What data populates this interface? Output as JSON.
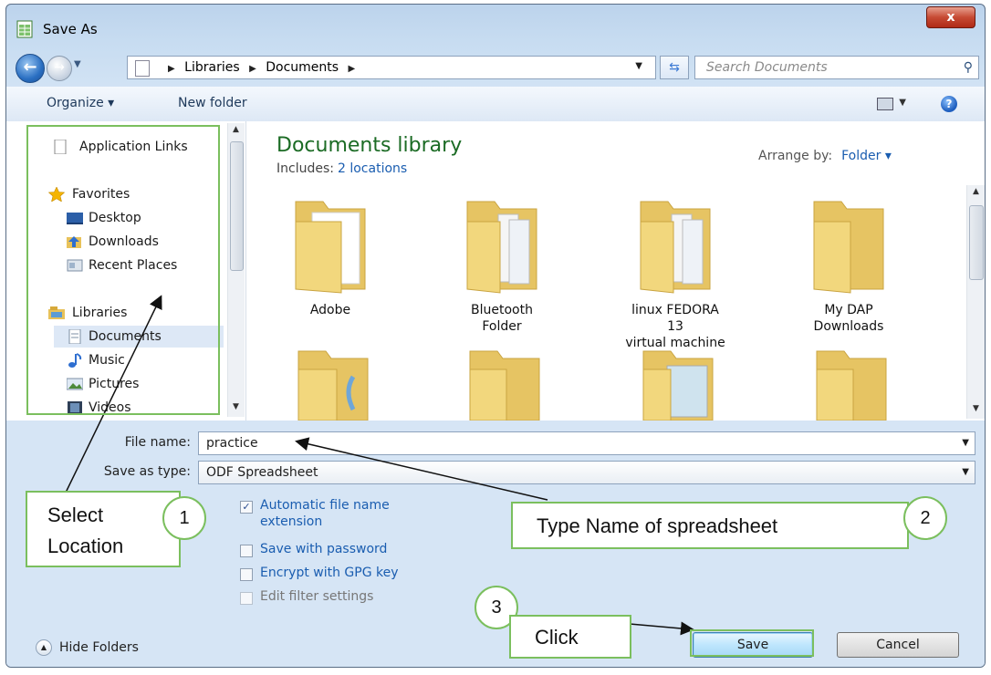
{
  "window": {
    "title": "Save As",
    "close_label": "x"
  },
  "address": {
    "crumbs": [
      "Libraries",
      "Documents"
    ],
    "search_placeholder": "Search Documents"
  },
  "toolbar": {
    "organize": "Organize ▾",
    "new_folder": "New folder",
    "help": "?"
  },
  "nav": {
    "top_item": "Application Links",
    "favorites": {
      "header": "Favorites",
      "items": [
        "Desktop",
        "Downloads",
        "Recent Places"
      ]
    },
    "libraries": {
      "header": "Libraries",
      "items": [
        "Documents",
        "Music",
        "Pictures",
        "Videos"
      ],
      "selected": "Documents"
    }
  },
  "library": {
    "title": "Documents library",
    "includes_label": "Includes:",
    "includes_link": "2 locations",
    "arrange_label": "Arrange by:",
    "arrange_value": "Folder ▾"
  },
  "folders": [
    {
      "line1": "Adobe",
      "line2": "",
      "icon": "folder-with-document-icon"
    },
    {
      "line1": "Bluetooth Folder",
      "line2": "",
      "icon": "folder-with-pages-icon"
    },
    {
      "line1": "linux FEDORA 13",
      "line2": "virtual machine",
      "icon": "folder-with-pages-icon"
    },
    {
      "line1": "My DAP",
      "line2": "Downloads",
      "icon": "folder-icon"
    }
  ],
  "form": {
    "file_name_label": "File name:",
    "file_name_value": "practice",
    "save_type_label": "Save as type:",
    "save_type_value": "ODF Spreadsheet",
    "options": [
      {
        "label_line1": "Automatic file name",
        "label_line2": "extension",
        "checked": true,
        "enabled": true
      },
      {
        "label_line1": "Save with password",
        "label_line2": "",
        "checked": false,
        "enabled": true
      },
      {
        "label_line1": "Encrypt with GPG key",
        "label_line2": "",
        "checked": false,
        "enabled": true
      },
      {
        "label_line1": "Edit filter settings",
        "label_line2": "",
        "checked": false,
        "enabled": false
      }
    ],
    "hide_folders": "Hide Folders",
    "save_button": "Save",
    "cancel_button": "Cancel"
  },
  "annotations": {
    "select_location_line1": "Select",
    "select_location_line2": "Location",
    "type_name": "Type Name of spreadsheet",
    "click": "Click",
    "step1": "1",
    "step2": "2",
    "step3": "3",
    "annotation_color": "#7bbf5e"
  }
}
